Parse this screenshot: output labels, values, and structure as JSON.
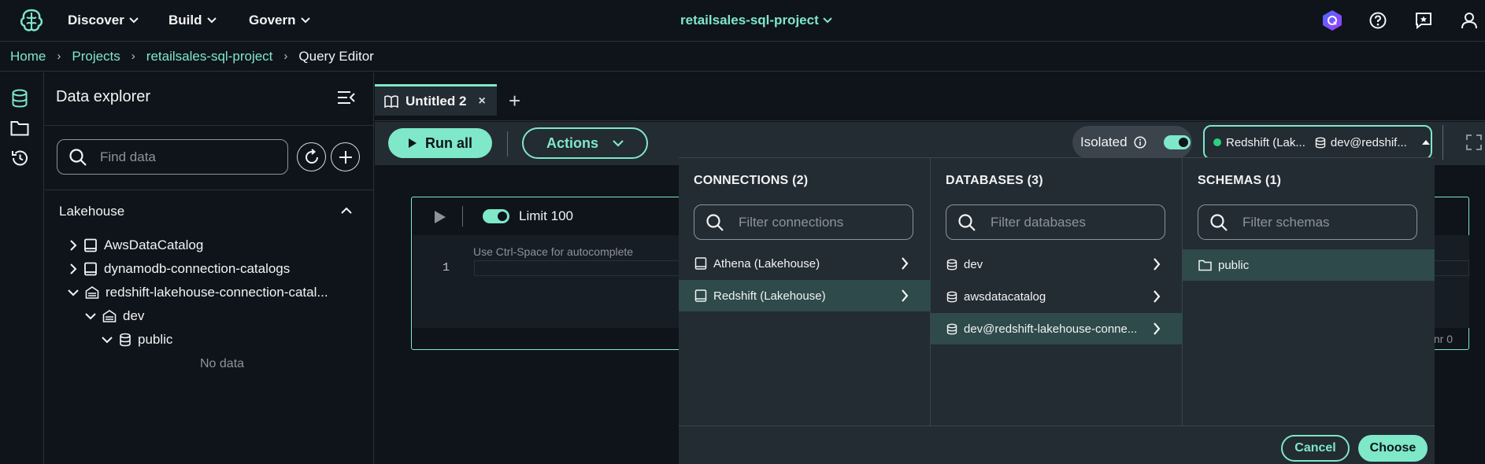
{
  "nav": {
    "discover": "Discover",
    "build": "Build",
    "govern": "Govern",
    "project": "retailsales-sql-project"
  },
  "breadcrumb": {
    "home": "Home",
    "projects": "Projects",
    "project": "retailsales-sql-project",
    "current": "Query Editor"
  },
  "explorer": {
    "title": "Data explorer",
    "search_placeholder": "Find data",
    "section": "Lakehouse",
    "tree": {
      "aws": "AwsDataCatalog",
      "dynamo": "dynamodb-connection-catalogs",
      "redshift": "redshift-lakehouse-connection-catal...",
      "dev": "dev",
      "public": "public",
      "nodata": "No data"
    }
  },
  "editor": {
    "tab_label": "Untitled 2",
    "tab_close": "×",
    "add_tab": "+",
    "run_all": "Run all",
    "actions": "Actions",
    "isolated": "Isolated",
    "connection_name": "Redshift (Lak...",
    "connection_db": "dev@redshif...",
    "limit": "Limit 100",
    "hint": "Use Ctrl-Space for autocomplete",
    "line": "1",
    "footer": "nr 0"
  },
  "picker": {
    "connections": {
      "title": "CONNECTIONS (2)",
      "placeholder": "Filter connections",
      "items": [
        "Athena (Lakehouse)",
        "Redshift (Lakehouse)"
      ]
    },
    "databases": {
      "title": "DATABASES (3)",
      "placeholder": "Filter databases",
      "items": [
        "dev",
        "awsdatacatalog",
        "dev@redshift-lakehouse-conne..."
      ]
    },
    "schemas": {
      "title": "SCHEMAS (1)",
      "placeholder": "Filter schemas",
      "items": [
        "public"
      ]
    },
    "cancel": "Cancel",
    "choose": "Choose"
  },
  "colors": {
    "accent": "#7ee8c9",
    "background": "#0f141a",
    "surface": "#232b33",
    "selected": "#2e4a4a"
  }
}
